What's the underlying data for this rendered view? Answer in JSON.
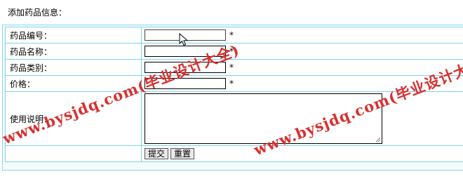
{
  "page": {
    "title": "添加药品信息："
  },
  "form": {
    "fields": [
      {
        "label": "药品编号：",
        "value": "",
        "required_mark": "*"
      },
      {
        "label": "药品名称：",
        "value": "",
        "required_mark": "*"
      },
      {
        "label": "药品类别：",
        "value": "",
        "required_mark": "*"
      },
      {
        "label": "价格：",
        "value": "",
        "required_mark": "*"
      }
    ],
    "description": {
      "label": "使用说明：",
      "value": ""
    },
    "buttons": {
      "submit": "提交",
      "reset": "重置"
    }
  },
  "watermark": {
    "text": "www.bysjdq.com(毕业设计大全)",
    "text_cropped": "www.bysjdq.com(毕业设计大",
    "color": "#d73030"
  },
  "colors": {
    "table_border": "#7fd4e6"
  }
}
